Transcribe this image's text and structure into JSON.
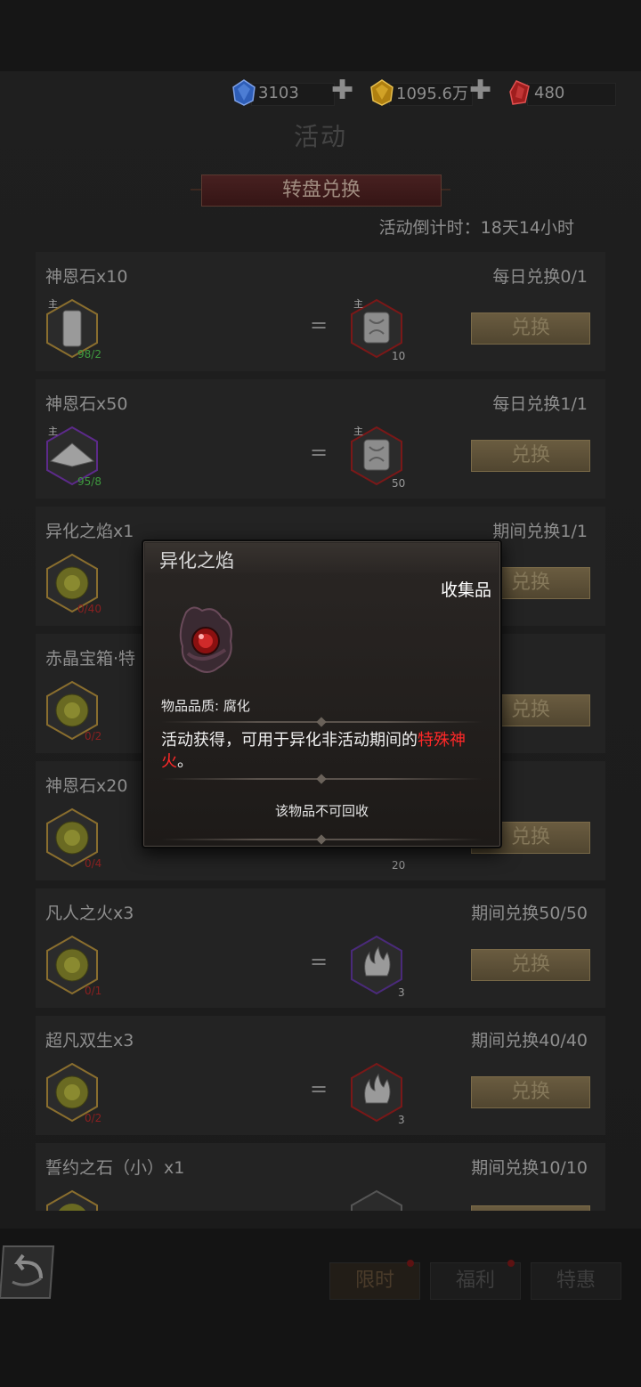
{
  "currencies": [
    {
      "name": "blue-gem",
      "value": "3103",
      "color": "#3a6fd0"
    },
    {
      "name": "gold-gem",
      "value": "1095.6万",
      "color": "#d4a020"
    },
    {
      "name": "red-gem",
      "value": "480",
      "color": "#c02828"
    }
  ],
  "page_title": "活动",
  "banner_title": "转盘兑换",
  "countdown": "活动倒计时：18天14小时",
  "main_tag": "主",
  "equals": "=",
  "exchange_label": "兑换",
  "cards": [
    {
      "title": "神恩石x10",
      "limit": "每日兑换0/1",
      "cost": "98/2",
      "reward_count": "10"
    },
    {
      "title": "神恩石x50",
      "limit": "每日兑换1/1",
      "cost": "95/8",
      "reward_count": "50"
    },
    {
      "title": "异化之焰x1",
      "limit": "期间兑换1/1",
      "cost": "0/40",
      "reward_count": ""
    },
    {
      "title": "赤晶宝箱·特",
      "limit": "",
      "cost": "0/2",
      "reward_count": ""
    },
    {
      "title": "神恩石x20",
      "limit": "",
      "cost": "0/4",
      "reward_count": "20"
    },
    {
      "title": "凡人之火x3",
      "limit": "期间兑换50/50",
      "cost": "0/1",
      "reward_count": "3"
    },
    {
      "title": "超凡双生x3",
      "limit": "期间兑换40/40",
      "cost": "0/2",
      "reward_count": "3"
    },
    {
      "title": "誓约之石（小）x1",
      "limit": "期间兑换10/10",
      "cost": "",
      "reward_count": ""
    }
  ],
  "tabs": [
    "限时",
    "福利",
    "特惠"
  ],
  "popup": {
    "title": "异化之焰",
    "type": "收集品",
    "quality": "物品品质: 腐化",
    "desc_normal": "活动获得，可用于异化非活动期间的",
    "desc_highlight": "特殊神火",
    "desc_end": "。",
    "note": "该物品不可回收"
  }
}
